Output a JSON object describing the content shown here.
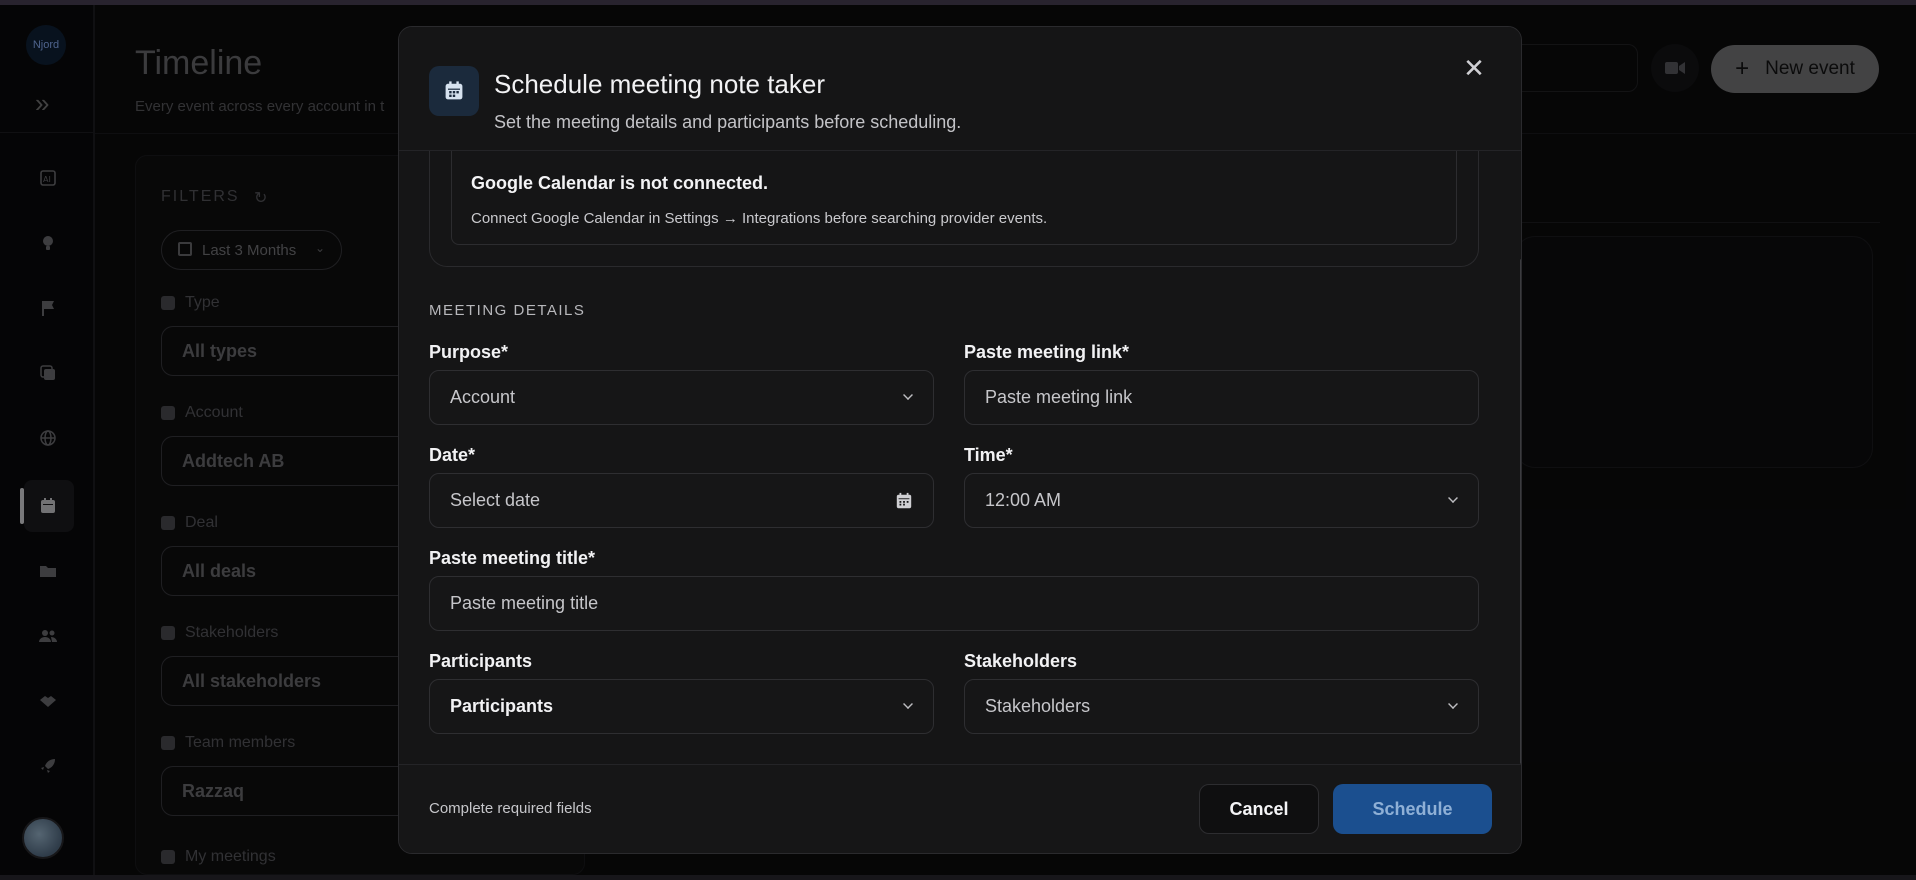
{
  "app": {
    "logo_text": "Njord",
    "page_title": "Timeline",
    "page_subtitle": "Every event across every account in t",
    "new_event_label": "New event"
  },
  "filters": {
    "heading": "FILTERS",
    "date_range": "Last 3 Months",
    "fields": [
      {
        "label": "Type",
        "value": "All types"
      },
      {
        "label": "Account",
        "value": "Addtech AB"
      },
      {
        "label": "Deal",
        "value": "All deals"
      },
      {
        "label": "Stakeholders",
        "value": "All stakeholders"
      },
      {
        "label": "Team members",
        "value": "Razzaq"
      },
      {
        "label": "My meetings",
        "value": ""
      }
    ]
  },
  "sidebar": {
    "icons": [
      "ai-icon",
      "lightbulb-icon",
      "flag-icon",
      "copy-plus-icon",
      "globe-icon",
      "calendar-icon",
      "folder-icon",
      "users-icon",
      "handshake-icon",
      "rocket-icon"
    ],
    "active": "calendar-icon"
  },
  "modal": {
    "title": "Schedule meeting note taker",
    "subtitle": "Set the meeting details and participants before scheduling.",
    "calendar_notice": {
      "title": "Google Calendar is not connected.",
      "description": "Connect Google Calendar in Settings → Integrations before searching provider events."
    },
    "section_heading": "MEETING DETAILS",
    "purpose": {
      "label": "Purpose*",
      "value": "Account"
    },
    "meeting_link": {
      "label": "Paste meeting link*",
      "placeholder": "Paste meeting link"
    },
    "date": {
      "label": "Date*",
      "placeholder": "Select date"
    },
    "time": {
      "label": "Time*",
      "value": "12:00 AM"
    },
    "meeting_title": {
      "label": "Paste meeting title*",
      "placeholder": "Paste meeting title"
    },
    "participants": {
      "label": "Participants",
      "value": "Participants"
    },
    "stakeholders": {
      "label": "Stakeholders",
      "value": "Stakeholders"
    },
    "footer_note": "Complete required fields",
    "cancel_label": "Cancel",
    "schedule_label": "Schedule",
    "colors": {
      "primary": "#1b4f8f",
      "background": "#151516"
    }
  }
}
